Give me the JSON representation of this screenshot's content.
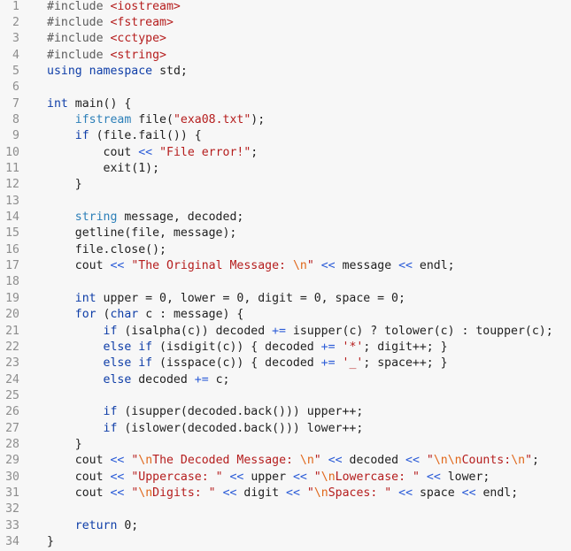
{
  "editor": {
    "lines": [
      {
        "n": "1",
        "segs": [
          [
            "pp",
            "#include "
          ],
          [
            "str",
            "<iostream>"
          ]
        ]
      },
      {
        "n": "2",
        "segs": [
          [
            "pp",
            "#include "
          ],
          [
            "str",
            "<fstream>"
          ]
        ]
      },
      {
        "n": "3",
        "segs": [
          [
            "pp",
            "#include "
          ],
          [
            "str",
            "<cctype>"
          ]
        ]
      },
      {
        "n": "4",
        "segs": [
          [
            "pp",
            "#include "
          ],
          [
            "str",
            "<string>"
          ]
        ]
      },
      {
        "n": "5",
        "segs": [
          [
            "kw",
            "using"
          ],
          [
            "id",
            " "
          ],
          [
            "kw",
            "namespace"
          ],
          [
            "id",
            " std;"
          ]
        ]
      },
      {
        "n": "6",
        "segs": []
      },
      {
        "n": "7",
        "segs": [
          [
            "kw",
            "int"
          ],
          [
            "id",
            " main() {"
          ]
        ]
      },
      {
        "n": "8",
        "segs": [
          [
            "id",
            "    "
          ],
          [
            "ty",
            "ifstream"
          ],
          [
            "id",
            " file("
          ],
          [
            "str",
            "\"exa08.txt\""
          ],
          [
            "id",
            ");"
          ]
        ]
      },
      {
        "n": "9",
        "segs": [
          [
            "id",
            "    "
          ],
          [
            "kw",
            "if"
          ],
          [
            "id",
            " (file.fail()) {"
          ]
        ]
      },
      {
        "n": "10",
        "segs": [
          [
            "id",
            "        cout "
          ],
          [
            "op",
            "<<"
          ],
          [
            "id",
            " "
          ],
          [
            "str",
            "\"File error!\""
          ],
          [
            "id",
            ";"
          ]
        ]
      },
      {
        "n": "11",
        "segs": [
          [
            "id",
            "        exit(1);"
          ]
        ]
      },
      {
        "n": "12",
        "segs": [
          [
            "id",
            "    }"
          ]
        ]
      },
      {
        "n": "13",
        "segs": []
      },
      {
        "n": "14",
        "segs": [
          [
            "id",
            "    "
          ],
          [
            "ty",
            "string"
          ],
          [
            "id",
            " message, decoded;"
          ]
        ]
      },
      {
        "n": "15",
        "segs": [
          [
            "id",
            "    getline(file, message);"
          ]
        ]
      },
      {
        "n": "16",
        "segs": [
          [
            "id",
            "    file.close();"
          ]
        ]
      },
      {
        "n": "17",
        "segs": [
          [
            "id",
            "    cout "
          ],
          [
            "op",
            "<<"
          ],
          [
            "id",
            " "
          ],
          [
            "str",
            "\"The Original Message: "
          ],
          [
            "esc",
            "\\n"
          ],
          [
            "str",
            "\""
          ],
          [
            "id",
            " "
          ],
          [
            "op",
            "<<"
          ],
          [
            "id",
            " message "
          ],
          [
            "op",
            "<<"
          ],
          [
            "id",
            " endl;"
          ]
        ]
      },
      {
        "n": "18",
        "segs": []
      },
      {
        "n": "19",
        "segs": [
          [
            "id",
            "    "
          ],
          [
            "kw",
            "int"
          ],
          [
            "id",
            " upper = 0, lower = 0, digit = 0, space = 0;"
          ]
        ]
      },
      {
        "n": "20",
        "segs": [
          [
            "id",
            "    "
          ],
          [
            "kw",
            "for"
          ],
          [
            "id",
            " ("
          ],
          [
            "kw",
            "char"
          ],
          [
            "id",
            " c : message) {"
          ]
        ]
      },
      {
        "n": "21",
        "segs": [
          [
            "id",
            "        "
          ],
          [
            "kw",
            "if"
          ],
          [
            "id",
            " (isalpha(c)) decoded "
          ],
          [
            "op",
            "+="
          ],
          [
            "id",
            " isupper(c) ? tolower(c) : toupper(c);"
          ]
        ]
      },
      {
        "n": "22",
        "segs": [
          [
            "id",
            "        "
          ],
          [
            "kw",
            "else if"
          ],
          [
            "id",
            " (isdigit(c)) { decoded "
          ],
          [
            "op",
            "+="
          ],
          [
            "id",
            " "
          ],
          [
            "str",
            "'*'"
          ],
          [
            "id",
            "; digit++; }"
          ]
        ]
      },
      {
        "n": "23",
        "segs": [
          [
            "id",
            "        "
          ],
          [
            "kw",
            "else if"
          ],
          [
            "id",
            " (isspace(c)) { decoded "
          ],
          [
            "op",
            "+="
          ],
          [
            "id",
            " "
          ],
          [
            "str",
            "'_'"
          ],
          [
            "id",
            "; space++; }"
          ]
        ]
      },
      {
        "n": "24",
        "segs": [
          [
            "id",
            "        "
          ],
          [
            "kw",
            "else"
          ],
          [
            "id",
            " decoded "
          ],
          [
            "op",
            "+="
          ],
          [
            "id",
            " c;"
          ]
        ]
      },
      {
        "n": "25",
        "segs": []
      },
      {
        "n": "26",
        "segs": [
          [
            "id",
            "        "
          ],
          [
            "kw",
            "if"
          ],
          [
            "id",
            " (isupper(decoded.back())) upper++;"
          ]
        ]
      },
      {
        "n": "27",
        "segs": [
          [
            "id",
            "        "
          ],
          [
            "kw",
            "if"
          ],
          [
            "id",
            " (islower(decoded.back())) lower++;"
          ]
        ]
      },
      {
        "n": "28",
        "segs": [
          [
            "id",
            "    }"
          ]
        ]
      },
      {
        "n": "29",
        "segs": [
          [
            "id",
            "    cout "
          ],
          [
            "op",
            "<<"
          ],
          [
            "id",
            " "
          ],
          [
            "str",
            "\""
          ],
          [
            "esc",
            "\\n"
          ],
          [
            "str",
            "The Decoded Message: "
          ],
          [
            "esc",
            "\\n"
          ],
          [
            "str",
            "\""
          ],
          [
            "id",
            " "
          ],
          [
            "op",
            "<<"
          ],
          [
            "id",
            " decoded "
          ],
          [
            "op",
            "<<"
          ],
          [
            "id",
            " "
          ],
          [
            "str",
            "\""
          ],
          [
            "esc",
            "\\n\\n"
          ],
          [
            "str",
            "Counts:"
          ],
          [
            "esc",
            "\\n"
          ],
          [
            "str",
            "\""
          ],
          [
            "id",
            ";"
          ]
        ]
      },
      {
        "n": "30",
        "segs": [
          [
            "id",
            "    cout "
          ],
          [
            "op",
            "<<"
          ],
          [
            "id",
            " "
          ],
          [
            "str",
            "\"Uppercase: \""
          ],
          [
            "id",
            " "
          ],
          [
            "op",
            "<<"
          ],
          [
            "id",
            " upper "
          ],
          [
            "op",
            "<<"
          ],
          [
            "id",
            " "
          ],
          [
            "str",
            "\""
          ],
          [
            "esc",
            "\\n"
          ],
          [
            "str",
            "Lowercase: \""
          ],
          [
            "id",
            " "
          ],
          [
            "op",
            "<<"
          ],
          [
            "id",
            " lower;"
          ]
        ]
      },
      {
        "n": "31",
        "segs": [
          [
            "id",
            "    cout "
          ],
          [
            "op",
            "<<"
          ],
          [
            "id",
            " "
          ],
          [
            "str",
            "\""
          ],
          [
            "esc",
            "\\n"
          ],
          [
            "str",
            "Digits: \""
          ],
          [
            "id",
            " "
          ],
          [
            "op",
            "<<"
          ],
          [
            "id",
            " digit "
          ],
          [
            "op",
            "<<"
          ],
          [
            "id",
            " "
          ],
          [
            "str",
            "\""
          ],
          [
            "esc",
            "\\n"
          ],
          [
            "str",
            "Spaces: \""
          ],
          [
            "id",
            " "
          ],
          [
            "op",
            "<<"
          ],
          [
            "id",
            " space "
          ],
          [
            "op",
            "<<"
          ],
          [
            "id",
            " endl;"
          ]
        ]
      },
      {
        "n": "32",
        "segs": []
      },
      {
        "n": "33",
        "segs": [
          [
            "id",
            "    "
          ],
          [
            "kw",
            "return"
          ],
          [
            "id",
            " 0;"
          ]
        ]
      },
      {
        "n": "34",
        "segs": [
          [
            "id",
            "}"
          ]
        ]
      }
    ]
  }
}
